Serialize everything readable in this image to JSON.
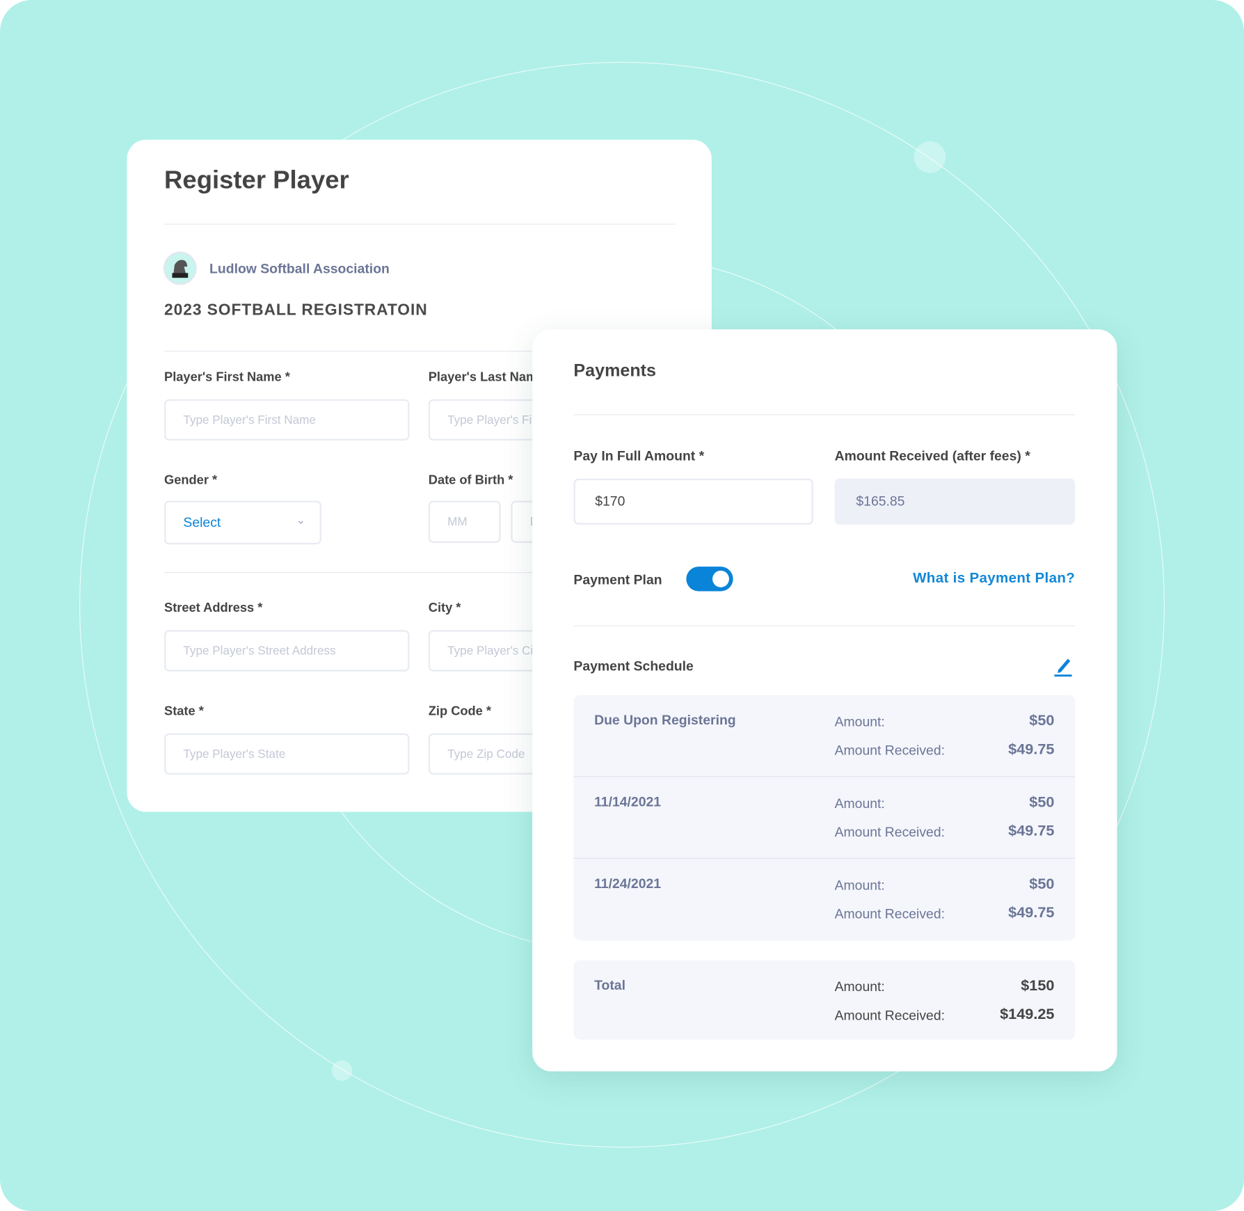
{
  "register": {
    "title": "Register Player",
    "org_name": "Ludlow Softball Association",
    "registration_title": "2023 SOFTBALL REGISTRATOIN",
    "first_name_label": "Player's First Name *",
    "first_name_placeholder": "Type Player's First Name",
    "last_name_label": "Player's Last Name *",
    "last_name_placeholder": "Type Player's First Name",
    "gender_label": "Gender *",
    "gender_value": "Select",
    "dob_label": "Date of Birth *",
    "dob_month_placeholder": "MM",
    "dob_day_placeholder": "DD",
    "street_label": "Street Address *",
    "street_placeholder": "Type Player's Street Address",
    "city_label": "City *",
    "city_placeholder": "Type Player's City",
    "state_label": "State *",
    "state_placeholder": "Type Player's State",
    "zip_label": "Zip Code *",
    "zip_placeholder": "Type Zip Code"
  },
  "payments": {
    "title": "Payments",
    "pay_full_label": "Pay In Full Amount *",
    "pay_full_value": "$170",
    "received_label": "Amount Received (after fees) *",
    "received_value": "$165.85",
    "plan_label": "Payment Plan",
    "plan_enabled": true,
    "plan_link": "What is Payment Plan?",
    "schedule_label": "Payment Schedule",
    "amount_key": "Amount:",
    "received_key": "Amount Received:",
    "schedule": [
      {
        "name": "Due Upon Registering",
        "amount": "$50",
        "received": "$49.75"
      },
      {
        "name": "11/14/2021",
        "amount": "$50",
        "received": "$49.75"
      },
      {
        "name": "11/24/2021",
        "amount": "$50",
        "received": "$49.75"
      }
    ],
    "total": {
      "name": "Total",
      "amount": "$150",
      "received": "$149.25"
    }
  },
  "colors": {
    "accent": "#0a84d8",
    "background": "#b0f0e8"
  }
}
